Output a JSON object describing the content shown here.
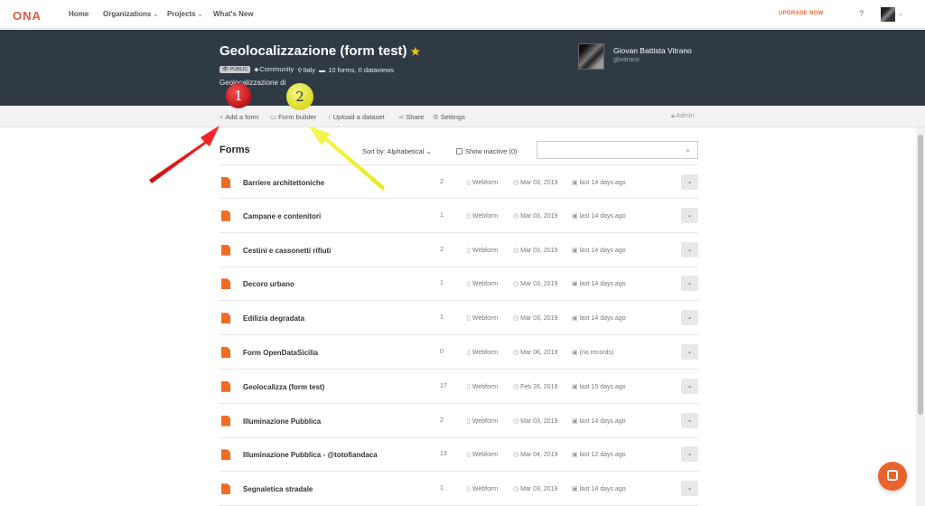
{
  "topnav": {
    "logo": "ONA",
    "home": "Home",
    "organizations": "Organizations",
    "projects": "Projects",
    "whats_new": "What's New",
    "upgrade": "UPGRADE NOW",
    "help": "?"
  },
  "project": {
    "title": "Geolocalizzazione (form test)",
    "visibility": "PUBLIC",
    "category": "Community",
    "location": "Italy",
    "stats": "10 forms, 0 dataviews",
    "description": "Geolocalizzazione di",
    "owner_name": "Giovan Battista Vitrano",
    "owner_username": "gbvitrano"
  },
  "toolbar": {
    "add_form": "Add a form",
    "form_builder": "Form builder",
    "upload_dataset": "Upload a dataset",
    "share": "Share",
    "settings": "Settings",
    "admin": "Admin"
  },
  "forms_header": {
    "title": "Forms",
    "sort_by": "Sort by: Alphabetical",
    "show_inactive": "Show inactive (0)",
    "search_placeholder": ""
  },
  "forms": [
    {
      "name": "Barriere architettoniche",
      "count": "2",
      "type": "Webform",
      "date": "Mar 03, 2019",
      "submission": "last 14 days ago"
    },
    {
      "name": "Campane e contenitori",
      "count": "1",
      "type": "Webform",
      "date": "Mar 03, 2019",
      "submission": "last 14 days ago"
    },
    {
      "name": "Cestini e cassonetti rifiuti",
      "count": "2",
      "type": "Webform",
      "date": "Mar 03, 2019",
      "submission": "last 14 days ago"
    },
    {
      "name": "Decoro urbano",
      "count": "1",
      "type": "Webform",
      "date": "Mar 03, 2019",
      "submission": "last 14 days ago"
    },
    {
      "name": "Edilizia degradata",
      "count": "1",
      "type": "Webform",
      "date": "Mar 03, 2019",
      "submission": "last 14 days ago"
    },
    {
      "name": "Form OpenDataSicilia",
      "count": "0",
      "type": "Webform",
      "date": "Mar 06, 2019",
      "submission": "(no records)"
    },
    {
      "name": "Geolocalizza (form test)",
      "count": "17",
      "type": "Webform",
      "date": "Feb 26, 2019",
      "submission": "last 15 days ago"
    },
    {
      "name": "Illuminazione Pubblica",
      "count": "2",
      "type": "Webform",
      "date": "Mar 03, 2019",
      "submission": "last 14 days ago"
    },
    {
      "name": "Illuminazione Pubblica - @totofiandaca",
      "count": "13",
      "type": "Webform",
      "date": "Mar 04, 2019",
      "submission": "last 12 days ago"
    },
    {
      "name": "Segnaletica stradale",
      "count": "1",
      "type": "Webform",
      "date": "Mar 03, 2019",
      "submission": "last 14 days ago"
    }
  ],
  "annotations": {
    "marker1": "1",
    "marker2": "2",
    "marker1_color": "#d81e1e",
    "marker2_color": "#e6e62a"
  },
  "colors": {
    "brand": "#e2563e",
    "header_bg": "#2f3a45",
    "file_icon": "#f26b21",
    "upgrade": "#e8642f"
  }
}
